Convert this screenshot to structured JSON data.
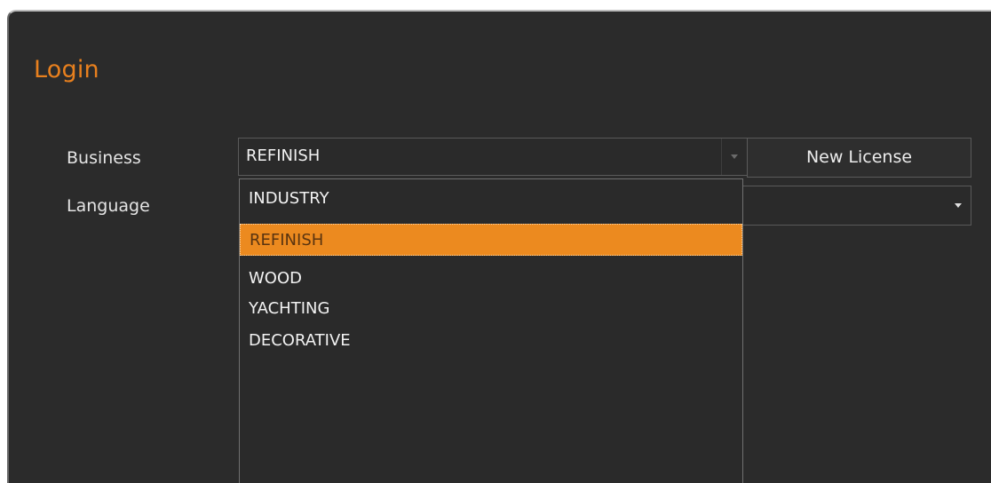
{
  "window": {
    "title": "Login"
  },
  "form": {
    "business_label": "Business",
    "language_label": "Language",
    "business_value": "REFINISH",
    "new_license_label": "New License",
    "language_value": ""
  },
  "dropdown": {
    "options": [
      "INDUSTRY",
      "REFINISH",
      "WOOD",
      "YACHTING",
      "DECORATIVE"
    ],
    "selected": "REFINISH"
  },
  "colors": {
    "accent": "#e8801e",
    "background": "#2b2b2b",
    "highlight": "#ec8a1f"
  },
  "icons": {
    "business_dropdown": "chevron-down-icon",
    "language_dropdown": "chevron-down-icon"
  }
}
